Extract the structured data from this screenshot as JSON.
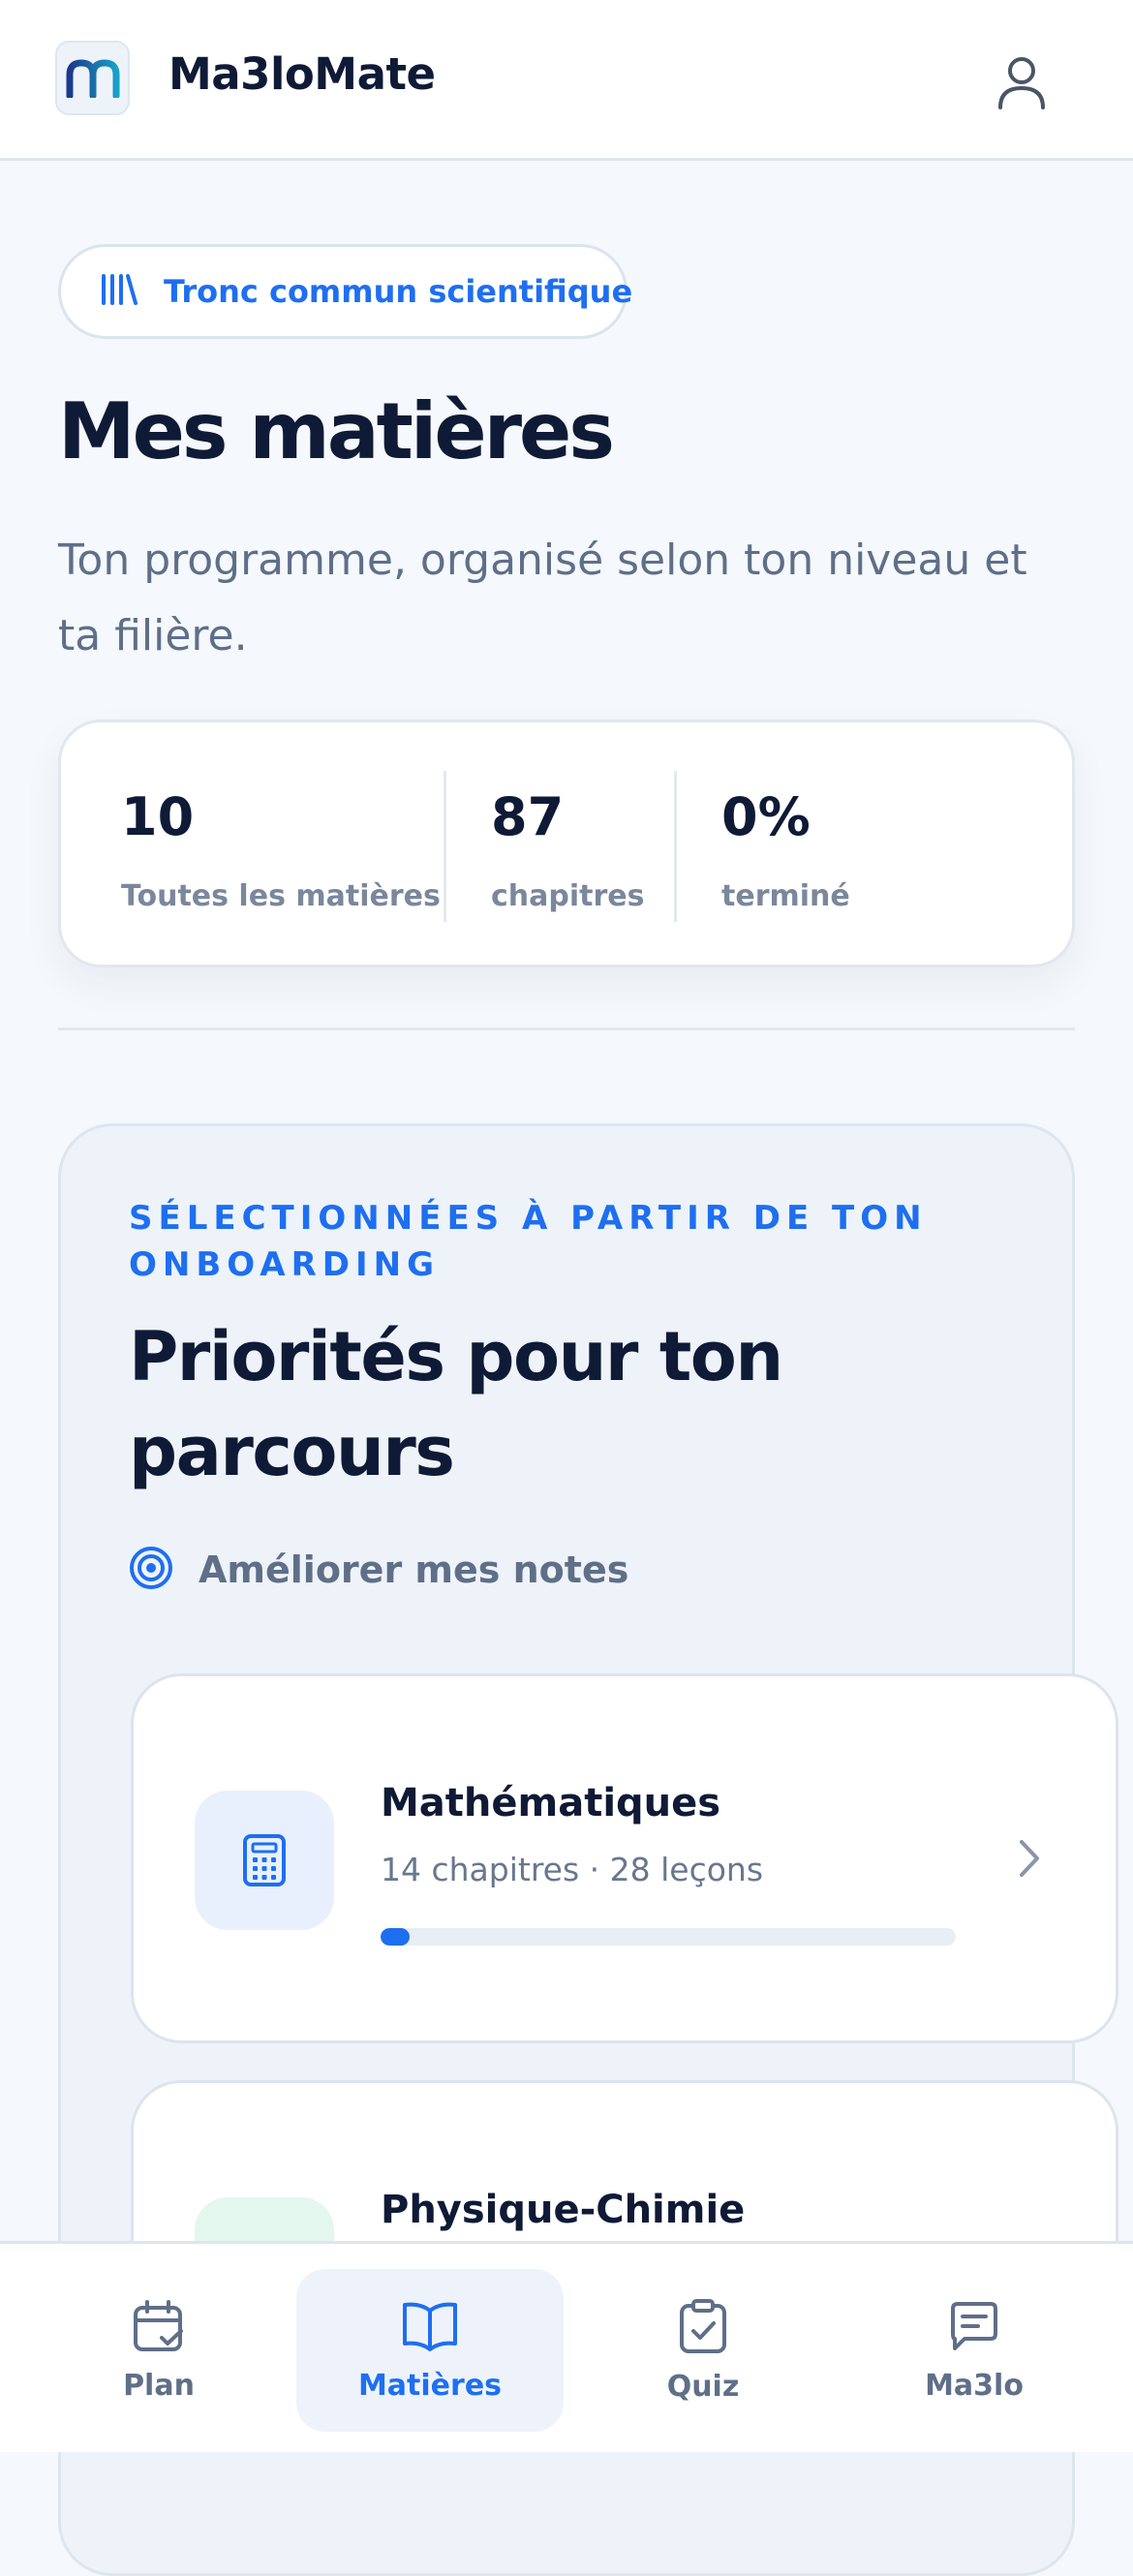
{
  "header": {
    "app_name": "Ma3loMate",
    "logo_icon": "brand-m-logo",
    "user_icon": "user-icon"
  },
  "track": {
    "icon": "library-icon",
    "label": "Tronc commun scientifique"
  },
  "page": {
    "title": "Mes matières",
    "subtitle": "Ton programme, organisé selon ton niveau et ta filière."
  },
  "stats": [
    {
      "value": "10",
      "label": "Toutes les matières"
    },
    {
      "value": "87",
      "label": "chapitres"
    },
    {
      "value": "0%",
      "label": "terminé"
    }
  ],
  "priorities": {
    "eyebrow": "Sélectionnées à partir de ton onboarding",
    "title": "Priorités pour ton parcours",
    "goal_icon": "target-icon",
    "goal": "Améliorer mes notes",
    "subjects": [
      {
        "name": "Mathématiques",
        "meta": "14 chapitres · 28 leçons",
        "icon": "calculator-icon",
        "progress": 0.05,
        "tile_color": "#e8f0fd",
        "icon_color": "#1e6ff0"
      },
      {
        "name": "Physique-Chimie",
        "meta": "",
        "icon": "atom-icon",
        "progress": 0,
        "tile_color": "#e3f7ee",
        "icon_color": "#1fa36a"
      }
    ]
  },
  "nav": {
    "items": [
      {
        "label": "Plan",
        "icon": "calendar-check-icon",
        "active": false
      },
      {
        "label": "Matières",
        "icon": "book-open-icon",
        "active": true
      },
      {
        "label": "Quiz",
        "icon": "clipboard-check-icon",
        "active": false
      },
      {
        "label": "Ma3lo",
        "icon": "chat-icon",
        "active": false
      }
    ]
  },
  "colors": {
    "accent": "#1e6ff0",
    "text_dark": "#0f1a36",
    "text_muted": "#5f6f88",
    "background": "#f5f8fc"
  }
}
